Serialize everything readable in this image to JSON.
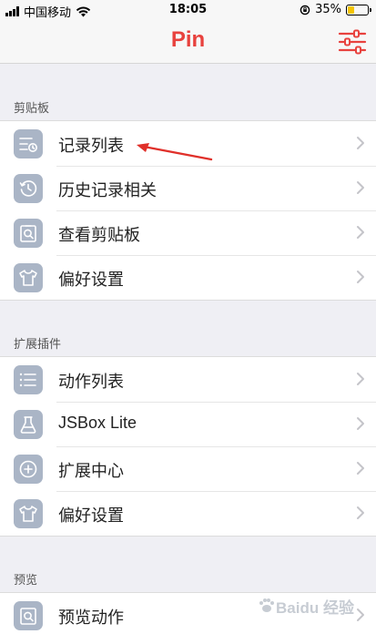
{
  "status_bar": {
    "carrier": "中国移动",
    "time": "18:05",
    "battery_percent": "35%",
    "battery_level": 0.35
  },
  "nav": {
    "title": "Pin",
    "filter_icon": "sliders-icon"
  },
  "sections": [
    {
      "header": "剪贴板",
      "items": [
        {
          "label": "记录列表",
          "icon": "list-clock-icon"
        },
        {
          "label": "历史记录相关",
          "icon": "history-clock-icon"
        },
        {
          "label": "查看剪贴板",
          "icon": "clipboard-search-icon"
        },
        {
          "label": "偏好设置",
          "icon": "shirt-icon"
        }
      ]
    },
    {
      "header": "扩展插件",
      "items": [
        {
          "label": "动作列表",
          "icon": "bullet-list-icon"
        },
        {
          "label": "JSBox Lite",
          "icon": "flask-icon"
        },
        {
          "label": "扩展中心",
          "icon": "plus-circle-icon"
        },
        {
          "label": "偏好设置",
          "icon": "shirt-icon"
        }
      ]
    },
    {
      "header": "预览",
      "items": [
        {
          "label": "预览动作",
          "icon": "preview-icon"
        }
      ]
    }
  ],
  "watermark": {
    "text": "Baidu 经验"
  },
  "colors": {
    "accent": "#e8423e",
    "icon_tile": "#aab5c6",
    "background": "#efeff4"
  }
}
